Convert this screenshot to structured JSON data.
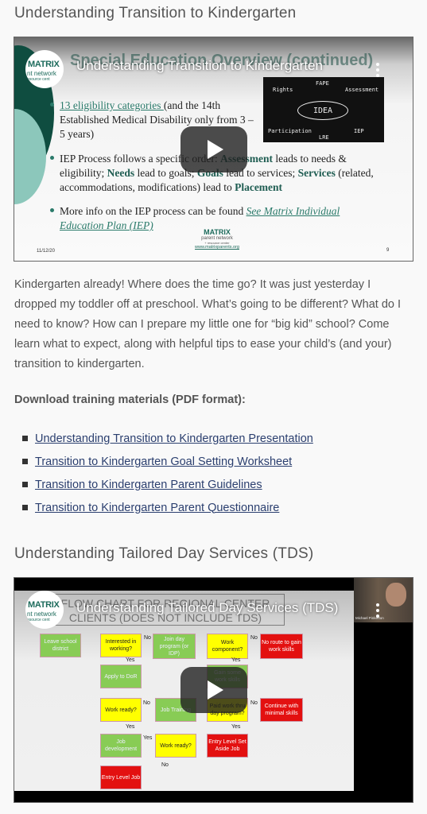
{
  "sections": [
    {
      "heading": "Understanding Transition to Kindergarten",
      "video": {
        "title": "Understanding Transition to Kindergarten",
        "channel_logo": {
          "brand": "MATRIX",
          "line1": "nt network",
          "line2": "esource cent"
        },
        "slide": {
          "title": "Special Education Overview (continued)",
          "bullet1_link": "13 eligibility categories ",
          "bullet1_rest": "(and the 14th Established Medical Disability only from 3 – 5 years)",
          "bullet2_a": "IEP Process follows a specific order: ",
          "bullet2_assessment": "Assessment",
          "bullet2_b": " leads to needs & eligibility; ",
          "bullet2_needs": "Needs",
          "bullet2_c": " lead to goals; ",
          "bullet2_goals": "Goals",
          "bullet2_d": " lead to services; ",
          "bullet2_services": "Services",
          "bullet2_e": " (related, accommodations, modifications) lead to ",
          "bullet2_placement": "Placement",
          "bullet3_text": "More info on the IEP process can be found ",
          "bullet3_link": "See Matrix Individual Education Plan (IEP)",
          "date": "11/12/20",
          "page": "9",
          "footer_brand": "MATRIX",
          "footer_sub": "parent network",
          "footer_sub2": "+ resource center",
          "footer_url": "www.matrixparents.org",
          "diagram": {
            "center": "IDEA",
            "labels": [
              "Rights",
              "FAPE",
              "Assessment",
              "Participation",
              "LRE",
              "IEP"
            ]
          }
        }
      },
      "description": "Kindergarten already! Where does the time go? It was just yesterday I dropped my toddler off at preschool. What’s going to be different? What do I need to know? How can I prepare my little one for “big kid” school? Come learn what to expect, along with helpful tips to ease your child’s (and your) transition to kindergarten.",
      "downloads_label": "Download training materials (PDF format):",
      "downloads": [
        "Understanding Transition to Kindergarten Presentation",
        "Transition to Kindergarten Goal Setting Worksheet",
        "Transition to Kindergarten Parent Guidelines",
        "Transition to Kindergarten Parent Questionnaire"
      ]
    },
    {
      "heading": "Understanding Tailored Day Services (TDS)",
      "video": {
        "title": "Understanding Tailored Day Services (TDS)",
        "channel_logo": {
          "brand": "MATRIX",
          "line1": "nt network",
          "line2": "esource cent"
        },
        "presenter_name": "Michael Pinkerton",
        "slide": {
          "title": "FLOW CHART FOR REGIONAL CENTER CLIENTS (DOES NOT INCLUDE TDS)",
          "nodes": {
            "leave": "Leave school district",
            "interested": "Interested in working?",
            "join": "Join day program (or IDP)",
            "workcomp": "Work component?",
            "noroute": "No route to gain work skills",
            "dor": "Apply to DoR",
            "gain": "Gain some work skills",
            "ready1": "Work ready?",
            "training": "Job Training",
            "paid": "Paid work thru day program?",
            "continue": "Continue with minimal skills",
            "jobdev": "Job development",
            "ready2": "Work ready?",
            "setaside": "Entry Level Set Aside Job",
            "entry": "Entry Level Job"
          },
          "yes": "Yes",
          "no": "No"
        }
      }
    }
  ]
}
